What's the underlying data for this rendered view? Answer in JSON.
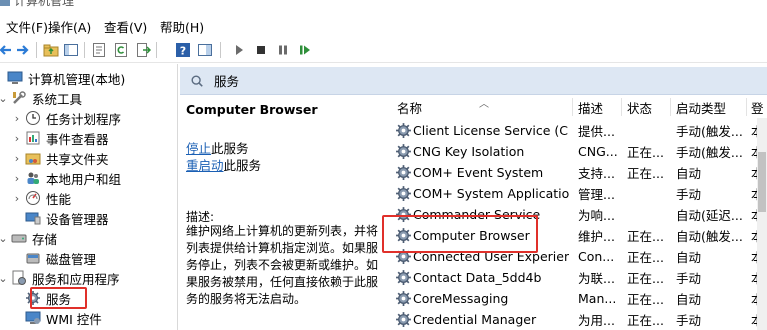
{
  "title": "计算机管理",
  "menu": [
    "文件(F)",
    "操作(A)",
    "查看(V)",
    "帮助(H)"
  ],
  "tree": [
    {
      "label": "计算机管理(本地)",
      "icon": "computer-icon",
      "chev": "",
      "indent": 0
    },
    {
      "label": "系统工具",
      "icon": "tools-icon",
      "chev": "⌄",
      "indent": 1
    },
    {
      "label": "任务计划程序",
      "icon": "clock-icon",
      "chev": "›",
      "indent": 2
    },
    {
      "label": "事件查看器",
      "icon": "event-viewer-icon",
      "chev": "›",
      "indent": 2
    },
    {
      "label": "共享文件夹",
      "icon": "shared-folder-icon",
      "chev": "›",
      "indent": 2
    },
    {
      "label": "本地用户和组",
      "icon": "users-icon",
      "chev": "›",
      "indent": 2
    },
    {
      "label": "性能",
      "icon": "performance-icon",
      "chev": "›",
      "indent": 2
    },
    {
      "label": "设备管理器",
      "icon": "device-manager-icon",
      "chev": "",
      "indent": 2
    },
    {
      "label": "存储",
      "icon": "storage-icon",
      "chev": "⌄",
      "indent": 1
    },
    {
      "label": "磁盘管理",
      "icon": "disk-icon",
      "chev": "",
      "indent": 2
    },
    {
      "label": "服务和应用程序",
      "icon": "services-apps-icon",
      "chev": "⌄",
      "indent": 1
    },
    {
      "label": "服务",
      "icon": "services-icon",
      "chev": "",
      "indent": 2
    },
    {
      "label": "WMI 控件",
      "icon": "wmi-icon",
      "chev": "",
      "indent": 2
    }
  ],
  "panel_title": "服务",
  "detail": {
    "service_name": "Computer Browser",
    "stop_link": "停止",
    "stop_suffix": "此服务",
    "restart_link": "重启动",
    "restart_suffix": "此服务",
    "desc_label": "描述:",
    "desc_text": "维护网络上计算机的更新列表，并将列表提供给计算机指定浏览。如果服务停止，列表不会被更新或维护。如果服务被禁用，任何直接依赖于此服务的服务将无法启动。"
  },
  "columns": [
    "名称",
    "描述",
    "状态",
    "启动类型",
    "登"
  ],
  "services": [
    {
      "name": "Client License Service (Cli...",
      "desc": "提供...",
      "status": "",
      "startup": "手动(触发...",
      "logon": "本"
    },
    {
      "name": "CNG Key Isolation",
      "desc": "CNG...",
      "status": "正在...",
      "startup": "手动(触发...",
      "logon": "本"
    },
    {
      "name": "COM+ Event System",
      "desc": "支持...",
      "status": "正在...",
      "startup": "自动",
      "logon": "本"
    },
    {
      "name": "COM+ System Application",
      "desc": "管理...",
      "status": "",
      "startup": "手动",
      "logon": "本"
    },
    {
      "name": "Commander Service",
      "desc": "为响...",
      "status": "",
      "startup": "自动(延迟...",
      "logon": "本"
    },
    {
      "name": "Computer Browser",
      "desc": "维护...",
      "status": "正在...",
      "startup": "自动(触发...",
      "logon": "本"
    },
    {
      "name": "Connected User Experien...",
      "desc": "Con...",
      "status": "正在...",
      "startup": "自动",
      "logon": "本"
    },
    {
      "name": "Contact Data_5dd4b",
      "desc": "为联...",
      "status": "正在...",
      "startup": "手动",
      "logon": "本"
    },
    {
      "name": "CoreMessaging",
      "desc": "Man...",
      "status": "正在...",
      "startup": "自动",
      "logon": "本"
    },
    {
      "name": "Credential Manager",
      "desc": "为用...",
      "status": "正在...",
      "startup": "手动",
      "logon": "本"
    }
  ],
  "colors": {
    "highlight": "#e0302a",
    "panel_header": "#dde7f3",
    "link": "#1a5fb4"
  }
}
